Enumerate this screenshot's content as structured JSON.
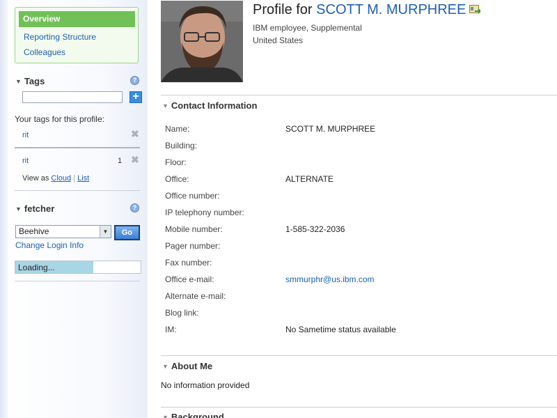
{
  "nav": {
    "overview": "Overview",
    "reporting": "Reporting Structure",
    "colleagues": "Colleagues"
  },
  "tags": {
    "title": "Tags",
    "your_tags_label": "Your tags for this profile:",
    "your_tag": "rit",
    "all_tag": "rit",
    "all_tag_count": "1",
    "view_as": "View as",
    "view_cloud": "Cloud",
    "view_list": "List",
    "input_value": ""
  },
  "fetcher": {
    "title": "fetcher",
    "selected": "Beehive",
    "go": "Go",
    "change_login": "Change Login Info",
    "loading": "Loading...",
    "progress": 0.62
  },
  "profile": {
    "title_prefix": "Profile for",
    "name": "SCOTT M. MURPHREE",
    "employee_type": "IBM employee, Supplemental",
    "country": "United States"
  },
  "contact": {
    "title": "Contact Information",
    "rows": [
      {
        "label": "Name:",
        "value": "SCOTT M. MURPHREE"
      },
      {
        "label": "Building:",
        "value": ""
      },
      {
        "label": "Floor:",
        "value": ""
      },
      {
        "label": "Office:",
        "value": "ALTERNATE"
      },
      {
        "label": "Office number:",
        "value": ""
      },
      {
        "label": "IP telephony number:",
        "value": ""
      },
      {
        "label": "Mobile number:",
        "value": "1-585-322-2036"
      },
      {
        "label": "Pager number:",
        "value": ""
      },
      {
        "label": "Fax number:",
        "value": ""
      },
      {
        "label": "Office e-mail:",
        "value": "smmurphr@us.ibm.com"
      },
      {
        "label": "Alternate e-mail:",
        "value": ""
      },
      {
        "label": "Blog link:",
        "value": ""
      },
      {
        "label": "IM:",
        "value": "No Sametime status available"
      }
    ]
  },
  "about": {
    "title": "About Me",
    "text": "No information provided"
  },
  "background": {
    "title": "Background"
  },
  "colors": {
    "accent": "#71c058",
    "link": "#1f5fb0"
  }
}
